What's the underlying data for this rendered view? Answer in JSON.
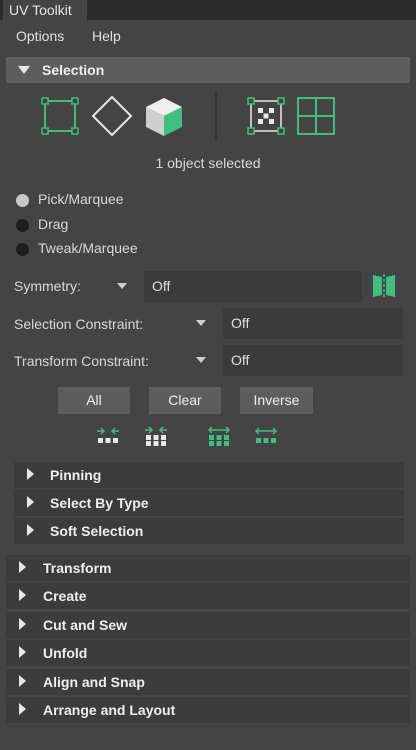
{
  "window": {
    "tab_title": "UV Toolkit"
  },
  "menu": {
    "options": "Options",
    "help": "Help"
  },
  "selection": {
    "header": "Selection",
    "status": "1 object selected",
    "modes": [
      {
        "label": "Pick/Marquee",
        "selected": true
      },
      {
        "label": "Drag",
        "selected": false
      },
      {
        "label": "Tweak/Marquee",
        "selected": false
      }
    ],
    "symmetry": {
      "label": "Symmetry:",
      "value": "Off"
    },
    "selection_constraint": {
      "label": "Selection Constraint:",
      "value": "Off"
    },
    "transform_constraint": {
      "label": "Transform Constraint:",
      "value": "Off"
    },
    "buttons": {
      "all": "All",
      "clear": "Clear",
      "inverse": "Inverse"
    },
    "subsections": [
      "Pinning",
      "Select By Type",
      "Soft Selection"
    ]
  },
  "sections": [
    "Transform",
    "Create",
    "Cut and Sew",
    "Unfold",
    "Align and Snap",
    "Arrange and Layout"
  ],
  "colors": {
    "accent_green": "#3fbf7f",
    "panel_bg": "#444444",
    "header_bg": "#5d5d5d",
    "field_bg": "#3b3b3b"
  }
}
